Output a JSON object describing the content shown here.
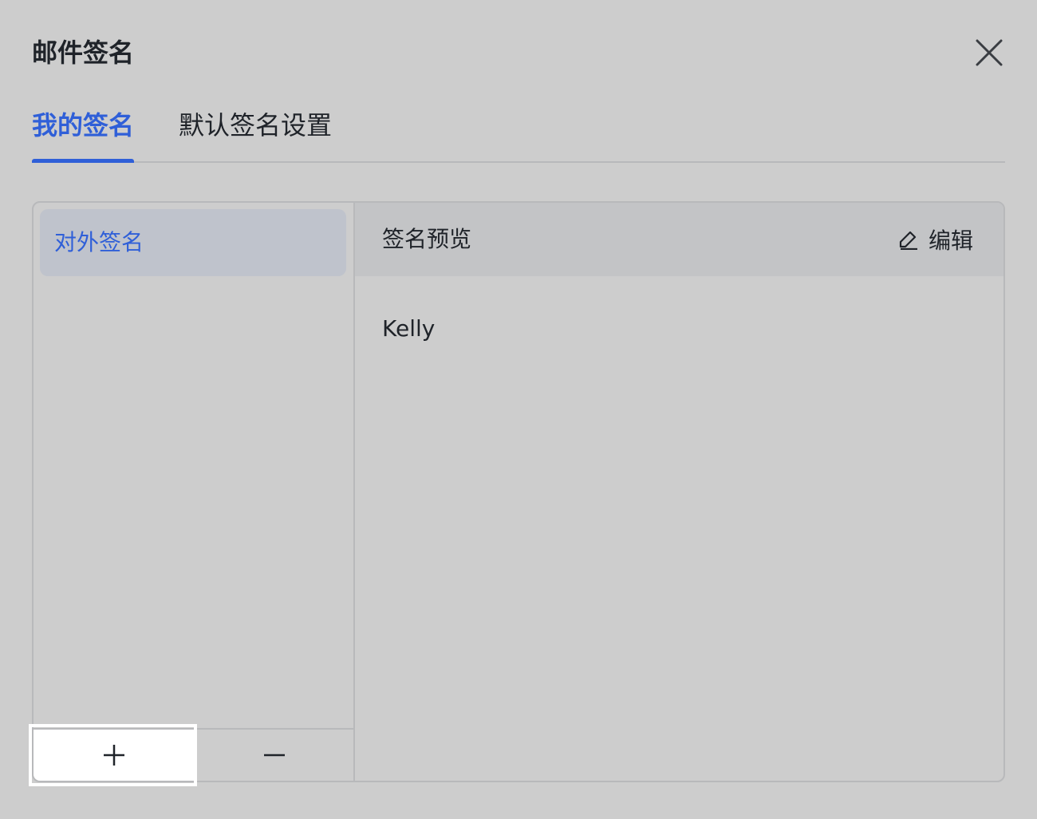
{
  "dialog": {
    "title": "邮件签名",
    "close_icon": "close-icon"
  },
  "tabs": [
    {
      "label": "我的签名",
      "active": true
    },
    {
      "label": "默认签名设置",
      "active": false
    }
  ],
  "signatures": {
    "items": [
      {
        "label": "对外签名",
        "selected": true
      }
    ],
    "add_icon": "plus-icon",
    "remove_icon": "minus-icon"
  },
  "preview": {
    "header_label": "签名预览",
    "edit_label": "编辑",
    "edit_icon": "pencil-icon",
    "content": "Kelly"
  },
  "colors": {
    "accent": "#2f5fd8",
    "background": "#cdcdcd",
    "selected_item": "#bfc3cc"
  }
}
